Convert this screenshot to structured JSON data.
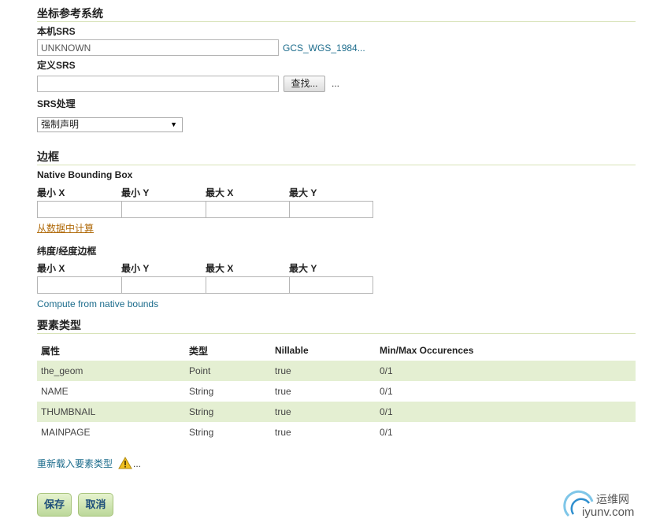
{
  "crs": {
    "title": "坐标参考系统",
    "native_srs_label": "本机SRS",
    "native_srs_value": "UNKNOWN",
    "native_srs_link": "GCS_WGS_1984...",
    "declared_srs_label": "定义SRS",
    "declared_srs_value": "",
    "find_button": "查找...",
    "declared_ellipsis": "...",
    "srs_handling_label": "SRS处理",
    "srs_handling_selected": "强制声明"
  },
  "bbox": {
    "title": "边框",
    "native_label": "Native Bounding Box",
    "col_labels": [
      "最小 X",
      "最小 Y",
      "最大 X",
      "最大 Y"
    ],
    "compute_from_data": "从数据中计算",
    "latlon_label": "纬度/经度边框",
    "compute_from_native": "Compute from native bounds"
  },
  "feature_type": {
    "title": "要素类型",
    "headers": [
      "属性",
      "类型",
      "Nillable",
      "Min/Max Occurences"
    ],
    "rows": [
      {
        "attr": "the_geom",
        "type": "Point",
        "nillable": "true",
        "occ": "0/1"
      },
      {
        "attr": "NAME",
        "type": "String",
        "nillable": "true",
        "occ": "0/1"
      },
      {
        "attr": "THUMBNAIL",
        "type": "String",
        "nillable": "true",
        "occ": "0/1"
      },
      {
        "attr": "MAINPAGE",
        "type": "String",
        "nillable": "true",
        "occ": "0/1"
      }
    ],
    "reload_link": "重新载入要素类型",
    "reload_ellipsis": "..."
  },
  "actions": {
    "save": "保存",
    "cancel": "取消"
  },
  "watermark": {
    "line1": "运维网",
    "line2": "iyunv.com"
  },
  "colors": {
    "accent_teal": "#1c6c8c",
    "row_alt": "#e4efd2",
    "warning": "#f0c020"
  },
  "icons": {
    "warning": "warning-icon",
    "dropdown": "chevron-down-icon"
  }
}
